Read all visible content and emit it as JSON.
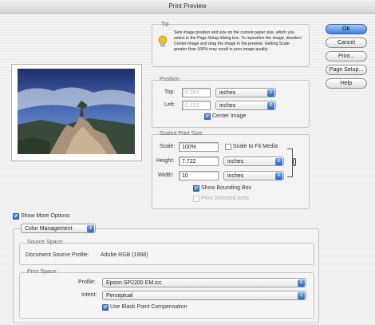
{
  "window": {
    "title": "Print Preview"
  },
  "tip": {
    "title": "Tip",
    "text": "Sets image position and size on the current paper size, which you select in the Page Setup dialog box. To reposition the image, deselect Center Image and drag the image in the preview. Getting Scale greater than 100% may result in poor image quality."
  },
  "buttons": {
    "ok": "OK",
    "cancel": "Cancel",
    "print": "Print...",
    "page_setup": "Page Setup...",
    "help": "Help"
  },
  "position": {
    "title": "Position",
    "top_label": "Top:",
    "top_value": "0.264",
    "top_unit": "inches",
    "left_label": "Left:",
    "left_value": "0.153",
    "left_unit": "inches",
    "center_image_label": "Center Image",
    "center_image_checked": true
  },
  "scaled": {
    "title": "Scaled Print Size",
    "scale_label": "Scale:",
    "scale_value": "100%",
    "fit_label": "Scale to Fit Media",
    "fit_checked": false,
    "height_label": "Height:",
    "height_value": "7.722",
    "height_unit": "inches",
    "width_label": "Width:",
    "width_value": "10",
    "width_unit": "inches",
    "bbox_label": "Show Bounding Box",
    "bbox_checked": true,
    "selected_label": "Print Selected Area",
    "selected_checked": false
  },
  "more_options": {
    "label": "Show More Options",
    "checked": true
  },
  "color_mgmt": {
    "popup": "Color Management",
    "source_title": "Source Space:",
    "doc_profile_label": "Document Source Profile:",
    "doc_profile_value": "Adobe RGB (1998)",
    "print_title": "Print Space:",
    "profile_label": "Profile:",
    "profile_value": "Epson SP2200 EM.icc",
    "intent_label": "Intent:",
    "intent_value": "Perceptual",
    "bpc_label": "Use Black Point Compensation",
    "bpc_checked": true
  },
  "colors": {
    "accent": "#3e7fdc",
    "bulb": "#f2c21b"
  },
  "icons": {
    "tip": "lightbulb-icon",
    "check": "checkmark-icon",
    "popup": "updown-arrows-icon",
    "link": "chain-link-icon"
  }
}
